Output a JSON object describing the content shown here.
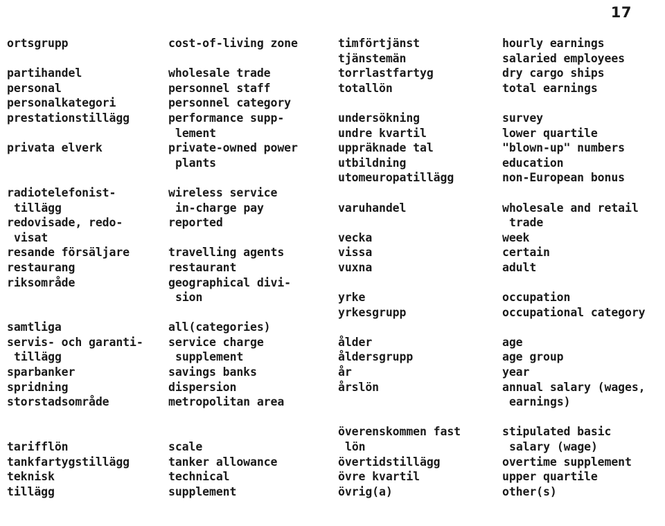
{
  "page": {
    "number": "17",
    "kind": "swedish-english glossary"
  },
  "columns": {
    "swedish_left_label": "swedish-terms-column-1",
    "english_left_label": "english-terms-column-1",
    "swedish_right_label": "swedish-terms-column-2",
    "english_right_label": "english-terms-column-2"
  },
  "glossary": {
    "swedish_left": [
      {
        "text": "ortsgrupp",
        "cont": false
      },
      {
        "text": "",
        "cont": false
      },
      {
        "text": "partihandel",
        "cont": false
      },
      {
        "text": "personal",
        "cont": false
      },
      {
        "text": "personalkategori",
        "cont": false
      },
      {
        "text": "prestationstillägg",
        "cont": false
      },
      {
        "text": "",
        "cont": false
      },
      {
        "text": "privata elverk",
        "cont": false
      },
      {
        "text": "",
        "cont": false
      },
      {
        "text": "",
        "cont": false
      },
      {
        "text": "radiotelefonist-",
        "cont": false
      },
      {
        "text": "tillägg",
        "cont": true
      },
      {
        "text": "redovisade, redo-",
        "cont": false
      },
      {
        "text": "visat",
        "cont": true
      },
      {
        "text": "resande försäljare",
        "cont": false
      },
      {
        "text": "restaurang",
        "cont": false
      },
      {
        "text": "riksområde",
        "cont": false
      },
      {
        "text": "",
        "cont": false
      },
      {
        "text": "",
        "cont": false
      },
      {
        "text": "samtliga",
        "cont": false
      },
      {
        "text": "servis- och garanti-",
        "cont": false
      },
      {
        "text": "tillägg",
        "cont": true
      },
      {
        "text": "sparbanker",
        "cont": false
      },
      {
        "text": "spridning",
        "cont": false
      },
      {
        "text": "storstadsområde",
        "cont": false
      },
      {
        "text": "",
        "cont": false
      },
      {
        "text": "",
        "cont": false
      },
      {
        "text": "tarifflön",
        "cont": false
      },
      {
        "text": "tankfartygstillägg",
        "cont": false
      },
      {
        "text": "teknisk",
        "cont": false
      },
      {
        "text": "tillägg",
        "cont": false
      }
    ],
    "english_left": [
      {
        "text": "cost-of-living zone",
        "cont": false
      },
      {
        "text": "",
        "cont": false
      },
      {
        "text": "wholesale trade",
        "cont": false
      },
      {
        "text": "personnel staff",
        "cont": false
      },
      {
        "text": "personnel category",
        "cont": false
      },
      {
        "text": "performance supp-",
        "cont": false
      },
      {
        "text": "lement",
        "cont": true
      },
      {
        "text": "private-owned power",
        "cont": false
      },
      {
        "text": "plants",
        "cont": true
      },
      {
        "text": "",
        "cont": false
      },
      {
        "text": "wireless service",
        "cont": false
      },
      {
        "text": "in-charge pay",
        "cont": true
      },
      {
        "text": "reported",
        "cont": false
      },
      {
        "text": "",
        "cont": false
      },
      {
        "text": "travelling agents",
        "cont": false
      },
      {
        "text": "restaurant",
        "cont": false
      },
      {
        "text": "geographical divi-",
        "cont": false
      },
      {
        "text": "sion",
        "cont": true
      },
      {
        "text": "",
        "cont": false
      },
      {
        "text": "all(categories)",
        "cont": false
      },
      {
        "text": "service charge",
        "cont": false
      },
      {
        "text": "supplement",
        "cont": true
      },
      {
        "text": "savings banks",
        "cont": false
      },
      {
        "text": "dispersion",
        "cont": false
      },
      {
        "text": "metropolitan area",
        "cont": false
      },
      {
        "text": "",
        "cont": false
      },
      {
        "text": "",
        "cont": false
      },
      {
        "text": "scale",
        "cont": false
      },
      {
        "text": "tanker allowance",
        "cont": false
      },
      {
        "text": "technical",
        "cont": false
      },
      {
        "text": "supplement",
        "cont": false
      }
    ],
    "swedish_right": [
      {
        "text": "timförtjänst",
        "cont": false
      },
      {
        "text": "tjänstemän",
        "cont": false
      },
      {
        "text": "torrlastfartyg",
        "cont": false
      },
      {
        "text": "totallön",
        "cont": false
      },
      {
        "text": "",
        "cont": false
      },
      {
        "text": "undersökning",
        "cont": false
      },
      {
        "text": "undre kvartil",
        "cont": false
      },
      {
        "text": "uppräknade tal",
        "cont": false
      },
      {
        "text": "utbildning",
        "cont": false
      },
      {
        "text": "utomeuropatillägg",
        "cont": false
      },
      {
        "text": "",
        "cont": false
      },
      {
        "text": "varuhandel",
        "cont": false
      },
      {
        "text": "",
        "cont": false
      },
      {
        "text": "vecka",
        "cont": false
      },
      {
        "text": "vissa",
        "cont": false
      },
      {
        "text": "vuxna",
        "cont": false
      },
      {
        "text": "",
        "cont": false
      },
      {
        "text": "yrke",
        "cont": false
      },
      {
        "text": "yrkesgrupp",
        "cont": false
      },
      {
        "text": "",
        "cont": false
      },
      {
        "text": "ålder",
        "cont": false
      },
      {
        "text": "åldersgrupp",
        "cont": false
      },
      {
        "text": "år",
        "cont": false
      },
      {
        "text": "årslön",
        "cont": false
      },
      {
        "text": "",
        "cont": false
      },
      {
        "text": "",
        "cont": false
      },
      {
        "text": "överenskommen fast",
        "cont": false
      },
      {
        "text": "lön",
        "cont": true
      },
      {
        "text": "övertidstillägg",
        "cont": false
      },
      {
        "text": "övre kvartil",
        "cont": false
      },
      {
        "text": "övrig(a)",
        "cont": false
      }
    ],
    "english_right": [
      {
        "text": "hourly earnings",
        "cont": false
      },
      {
        "text": "salaried employees",
        "cont": false
      },
      {
        "text": "dry cargo ships",
        "cont": false
      },
      {
        "text": "total earnings",
        "cont": false
      },
      {
        "text": "",
        "cont": false
      },
      {
        "text": "survey",
        "cont": false
      },
      {
        "text": "lower quartile",
        "cont": false
      },
      {
        "text": "\"blown-up\" numbers",
        "cont": false
      },
      {
        "text": "education",
        "cont": false
      },
      {
        "text": "non-European bonus",
        "cont": false
      },
      {
        "text": "",
        "cont": false
      },
      {
        "text": "wholesale and retail",
        "cont": false
      },
      {
        "text": "trade",
        "cont": true
      },
      {
        "text": "week",
        "cont": false
      },
      {
        "text": "certain",
        "cont": false
      },
      {
        "text": "adult",
        "cont": false
      },
      {
        "text": "",
        "cont": false
      },
      {
        "text": "occupation",
        "cont": false
      },
      {
        "text": "occupational category",
        "cont": false
      },
      {
        "text": "",
        "cont": false
      },
      {
        "text": "age",
        "cont": false
      },
      {
        "text": "age group",
        "cont": false
      },
      {
        "text": "year",
        "cont": false
      },
      {
        "text": "annual salary (wages,",
        "cont": false
      },
      {
        "text": "earnings)",
        "cont": true
      },
      {
        "text": "",
        "cont": false
      },
      {
        "text": "stipulated basic",
        "cont": false
      },
      {
        "text": "salary (wage)",
        "cont": true
      },
      {
        "text": "overtime supplement",
        "cont": false
      },
      {
        "text": "upper quartile",
        "cont": false
      },
      {
        "text": "other(s)",
        "cont": false
      }
    ]
  }
}
